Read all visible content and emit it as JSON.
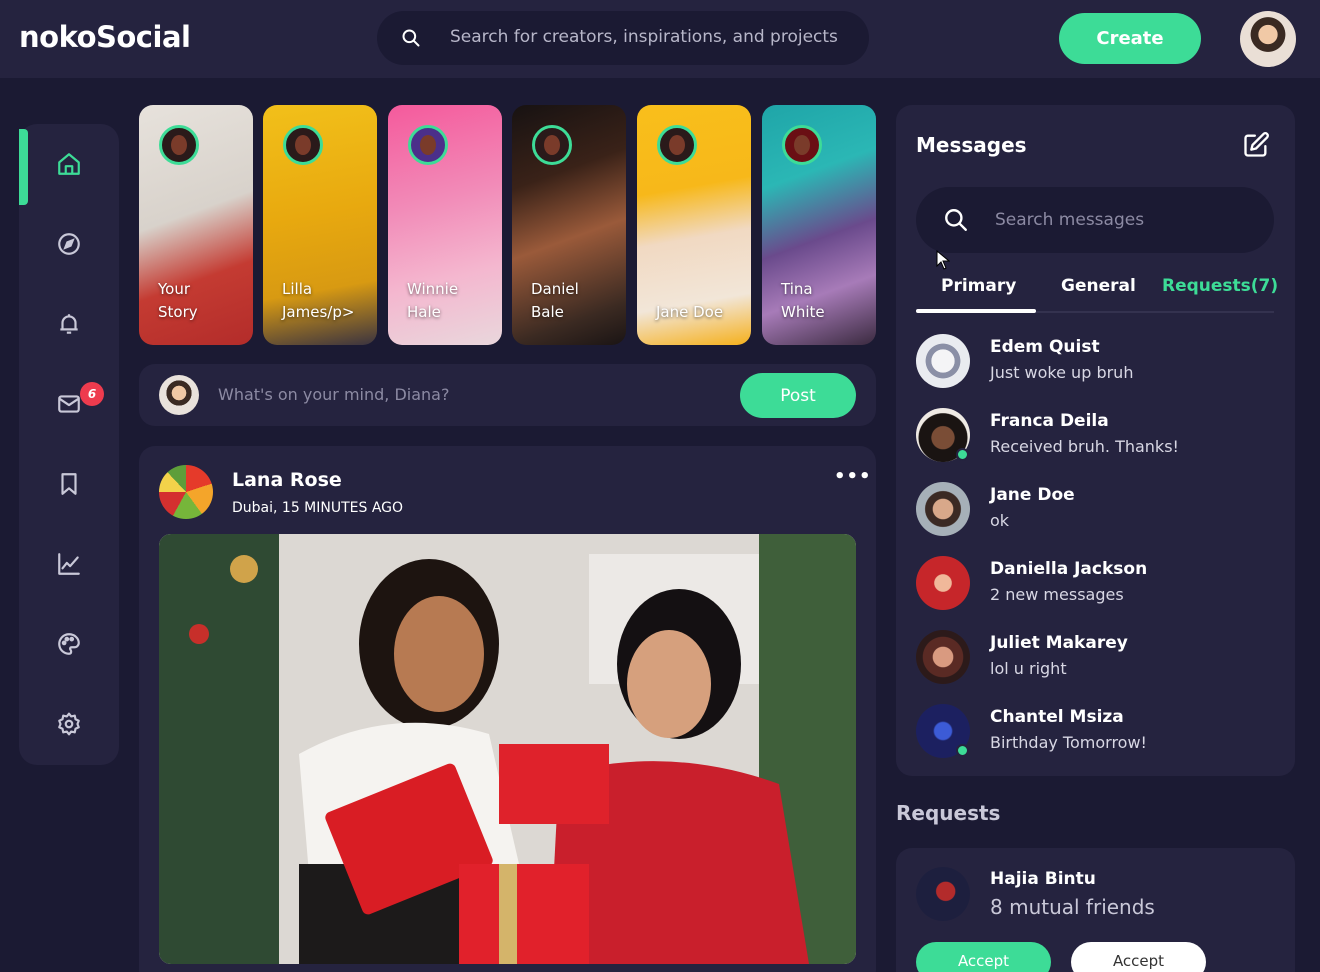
{
  "brand": {
    "name": "nokoSocial"
  },
  "search": {
    "placeholder": "Search for creators, inspirations, and projects"
  },
  "header": {
    "create_label": "Create"
  },
  "colors": {
    "accent": "#3ddc97",
    "background": "#1b1a33",
    "panel": "#25233f",
    "badge": "#ee3b4e"
  },
  "sidebar": {
    "items": [
      {
        "name": "home",
        "icon": "home-icon",
        "active": true
      },
      {
        "name": "explore",
        "icon": "compass-icon"
      },
      {
        "name": "notifications",
        "icon": "bell-icon"
      },
      {
        "name": "messages",
        "icon": "mail-icon",
        "badge": "6"
      },
      {
        "name": "bookmarks",
        "icon": "bookmark-icon"
      },
      {
        "name": "analytics",
        "icon": "chart-icon"
      },
      {
        "name": "theme",
        "icon": "palette-icon"
      },
      {
        "name": "settings",
        "icon": "gear-icon"
      }
    ]
  },
  "stories": [
    {
      "line1": "Your",
      "line2": "Story"
    },
    {
      "line1": "Lilla",
      "line2": "James/p>"
    },
    {
      "line1": "Winnie",
      "line2": "Hale"
    },
    {
      "line1": "Daniel",
      "line2": "Bale"
    },
    {
      "line1": "",
      "line2": "Jane Doe"
    },
    {
      "line1": "Tina",
      "line2": "White"
    }
  ],
  "composer": {
    "placeholder": "What's on your mind, Diana?",
    "post_label": "Post"
  },
  "feed": {
    "author": "Lana Rose",
    "meta": "Dubai, 15 MINUTES AGO",
    "more": "•••"
  },
  "messages": {
    "title": "Messages",
    "search_placeholder": "Search messages",
    "tabs": [
      {
        "label": "Primary"
      },
      {
        "label": "General"
      },
      {
        "label": "Requests(7)"
      }
    ],
    "items": [
      {
        "name": "Edem Quist",
        "text": "Just woke up bruh",
        "online": false
      },
      {
        "name": "Franca Deila",
        "text": "Received bruh. Thanks!",
        "online": true
      },
      {
        "name": "Jane Doe",
        "text": "ok",
        "online": false
      },
      {
        "name": "Daniella Jackson",
        "text": "2 new messages",
        "online": false
      },
      {
        "name": "Juliet Makarey",
        "text": "lol u right",
        "online": false
      },
      {
        "name": "Chantel Msiza",
        "text": "Birthday Tomorrow!",
        "online": true
      }
    ]
  },
  "requests": {
    "title": "Requests",
    "items": [
      {
        "name": "Hajia Bintu",
        "mutual": "8 mutual friends",
        "accept_label": "Accept",
        "decline_label": "Accept"
      }
    ]
  }
}
